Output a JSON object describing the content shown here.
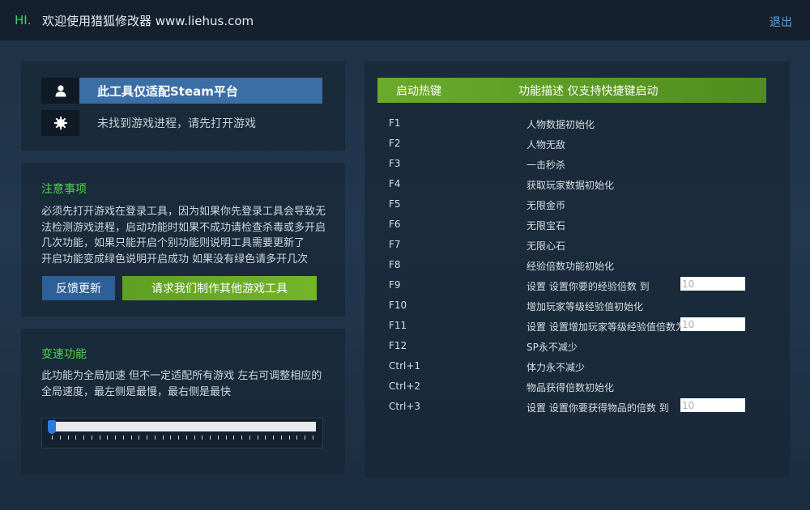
{
  "header": {
    "hi": "HI.",
    "title": "欢迎使用猎狐修改器 www.liehus.com",
    "logout": "退出"
  },
  "status": {
    "platform": "此工具仅适配Steam平台",
    "process": "未找到游戏进程，请先打开游戏",
    "user_icon": "user-icon",
    "process_icon": "gear-icon"
  },
  "notice": {
    "title": "注意事项",
    "lines": [
      "必须先打开游戏在登录工具，因为如果你先登录工具会导致无",
      "法检测游戏进程，启动功能时如果不成功请检查杀毒或多开启",
      "几次功能，如果只能开启个别功能则说明工具需要更新了",
      "开启功能变成绿色说明开启成功 如果没有绿色请多开几次"
    ],
    "feedback_button": "反馈更新",
    "request_button": "请求我们制作其他游戏工具"
  },
  "speed": {
    "title": "变速功能",
    "lines": [
      "此功能为全局加速 但不一定适配所有游戏 左右可调整相应的",
      "全局速度，最左侧是最慢，最右侧是最快"
    ],
    "value": 0
  },
  "hotkeys": {
    "col_key": "启动热键",
    "col_desc": "功能描述 仅支持快捷键启动",
    "rows": [
      {
        "key": "F1",
        "desc": "人物数据初始化"
      },
      {
        "key": "F2",
        "desc": "人物无敌"
      },
      {
        "key": "F3",
        "desc": "一击秒杀"
      },
      {
        "key": "F4",
        "desc": "获取玩家数据初始化"
      },
      {
        "key": "F5",
        "desc": "无限金币"
      },
      {
        "key": "F6",
        "desc": "无限宝石"
      },
      {
        "key": "F7",
        "desc": "无限心石"
      },
      {
        "key": "F8",
        "desc": "经验倍数功能初始化"
      },
      {
        "key": "F9",
        "desc": "设置 设置你要的经验倍数 到",
        "input": "10"
      },
      {
        "key": "F10",
        "desc": "增加玩家等级经验值初始化"
      },
      {
        "key": "F11",
        "desc": "设置 设置增加玩家等级经验值倍数为",
        "input": "10"
      },
      {
        "key": "F12",
        "desc": "SP永不减少"
      },
      {
        "key": "Ctrl+1",
        "desc": "体力永不减少"
      },
      {
        "key": "Ctrl+2",
        "desc": "物品获得倍数初始化"
      },
      {
        "key": "Ctrl+3",
        "desc": "设置 设置你要获得物品的倍数 到",
        "input": "10"
      }
    ]
  }
}
